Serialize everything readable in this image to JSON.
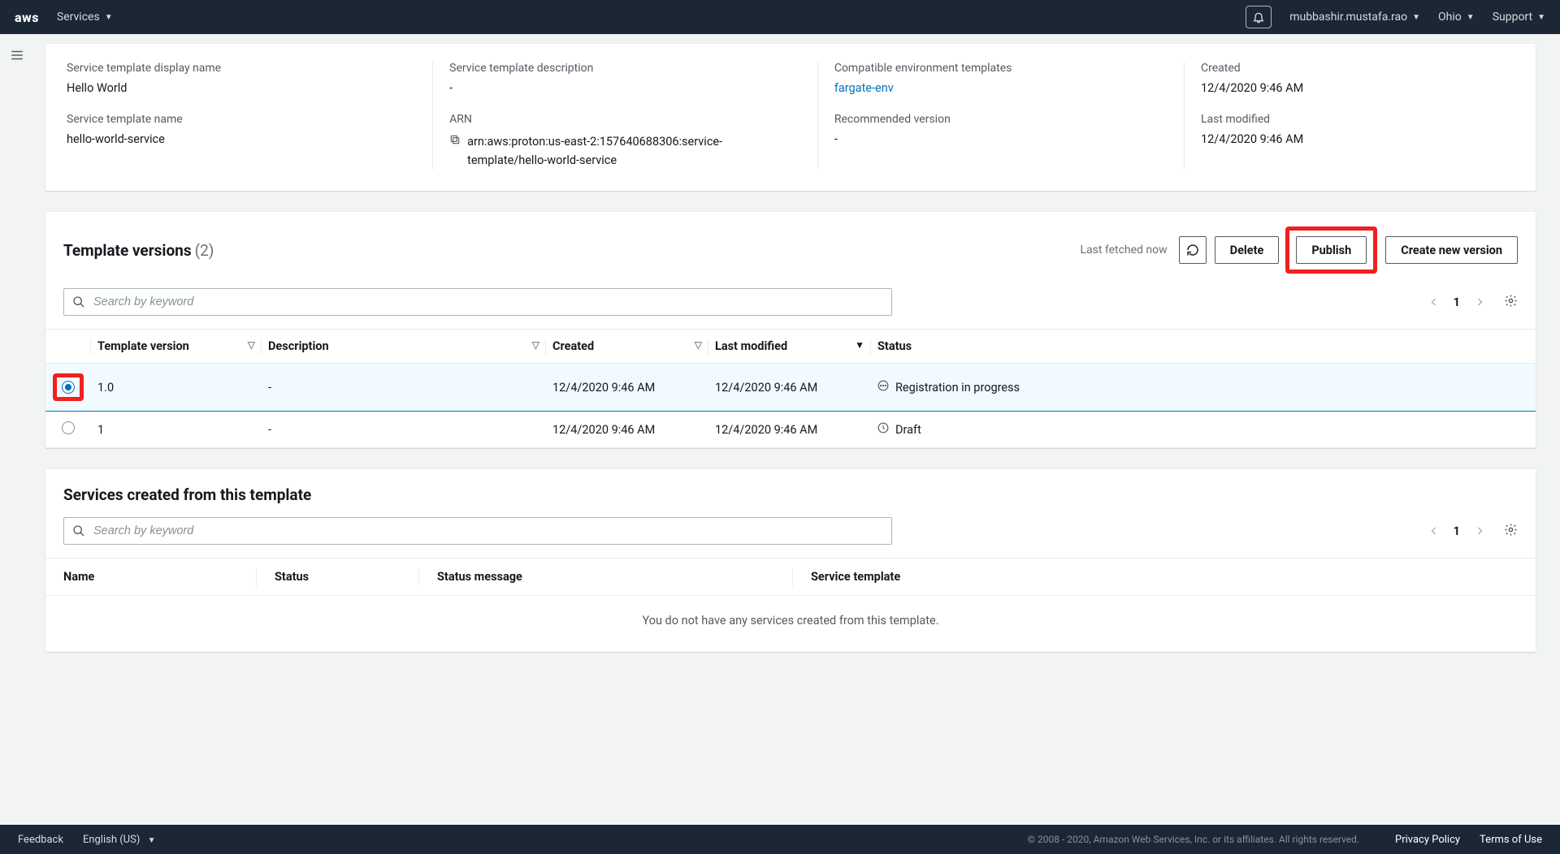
{
  "nav": {
    "services": "Services",
    "user": "mubbashir.mustafa.rao",
    "region": "Ohio",
    "support": "Support"
  },
  "details": {
    "displayNameLabel": "Service template display name",
    "displayName": "Hello World",
    "nameLabel": "Service template name",
    "name": "hello-world-service",
    "descLabel": "Service template description",
    "desc": "-",
    "arnLabel": "ARN",
    "arn": "arn:aws:proton:us-east-2:157640688306:service-template/hello-world-service",
    "compatLabel": "Compatible environment templates",
    "compat": "fargate-env",
    "recvLabel": "Recommended version",
    "recv": "-",
    "createdLabel": "Created",
    "created": "12/4/2020 9:46 AM",
    "modifiedLabel": "Last modified",
    "modified": "12/4/2020 9:46 AM"
  },
  "versions": {
    "title": "Template versions",
    "count": "(2)",
    "lastFetched": "Last fetched now",
    "delete": "Delete",
    "publish": "Publish",
    "create": "Create new version",
    "searchPlaceholder": "Search by keyword",
    "page": "1",
    "headers": {
      "tv": "Template version",
      "desc": "Description",
      "created": "Created",
      "modified": "Last modified",
      "status": "Status"
    },
    "rows": [
      {
        "selected": true,
        "version": "1.0",
        "desc": "-",
        "created": "12/4/2020 9:46 AM",
        "modified": "12/4/2020 9:46 AM",
        "status": "Registration in progress",
        "icon": "progress"
      },
      {
        "selected": false,
        "version": "1",
        "desc": "-",
        "created": "12/4/2020 9:46 AM",
        "modified": "12/4/2020 9:46 AM",
        "status": "Draft",
        "icon": "draft"
      }
    ]
  },
  "services": {
    "title": "Services created from this template",
    "searchPlaceholder": "Search by keyword",
    "page": "1",
    "headers": {
      "name": "Name",
      "status": "Status",
      "msg": "Status message",
      "tpl": "Service template"
    },
    "emptyMsg": "You do not have any services created from this template."
  },
  "footer": {
    "feedback": "Feedback",
    "lang": "English (US)",
    "copyright": "© 2008 - 2020, Amazon Web Services, Inc. or its affiliates. All rights reserved.",
    "privacy": "Privacy Policy",
    "terms": "Terms of Use"
  }
}
